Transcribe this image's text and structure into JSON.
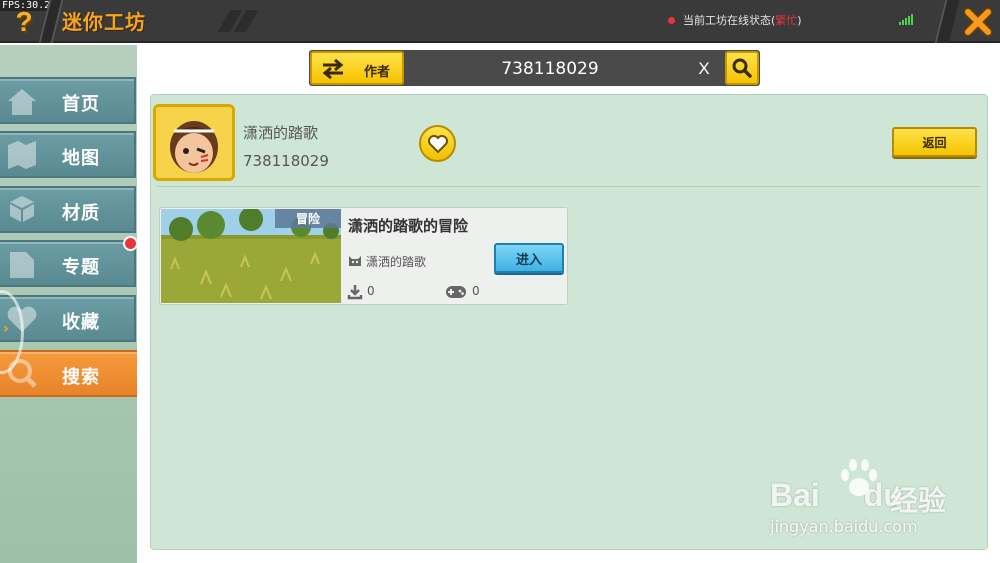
{
  "debug": {
    "fps": "FPS:30.2"
  },
  "header": {
    "help_icon": "question-mark",
    "title": "迷你工坊",
    "status_label": "当前工坊在线状态(",
    "status_value": "繁忙",
    "status_suffix": ")",
    "status_color": "#e8343a",
    "close_icon": "close-x"
  },
  "sidebar": {
    "items": [
      {
        "label": "首页",
        "icon": "home-icon",
        "active": false
      },
      {
        "label": "地图",
        "icon": "map-icon",
        "active": false
      },
      {
        "label": "材质",
        "icon": "texture-icon",
        "active": false
      },
      {
        "label": "专题",
        "icon": "topic-icon",
        "active": false,
        "badge": true
      },
      {
        "label": "收藏",
        "icon": "favorite-icon",
        "active": false
      },
      {
        "label": "搜索",
        "icon": "search-icon",
        "active": true
      }
    ]
  },
  "search": {
    "type_label": "作者",
    "value": "738118029",
    "clear_label": "X"
  },
  "author": {
    "name": "潇洒的踏歌",
    "id": "738118029",
    "back_label": "返回"
  },
  "maps": [
    {
      "type_tag": "冒险",
      "title": "潇洒的踏歌的冒险",
      "author": "潇洒的踏歌",
      "enter_label": "进入",
      "downloads": "0",
      "plays": "0"
    }
  ],
  "watermark": {
    "logo_text": "Bai",
    "logo_suffix": "du",
    "brand": "经验",
    "url": "jingyan.baidu.com"
  },
  "colors": {
    "accent_yellow": "#f5c400",
    "active_nav": "#f59a3b",
    "nav": "#6c9da4",
    "panel": "#cfe6d6"
  }
}
